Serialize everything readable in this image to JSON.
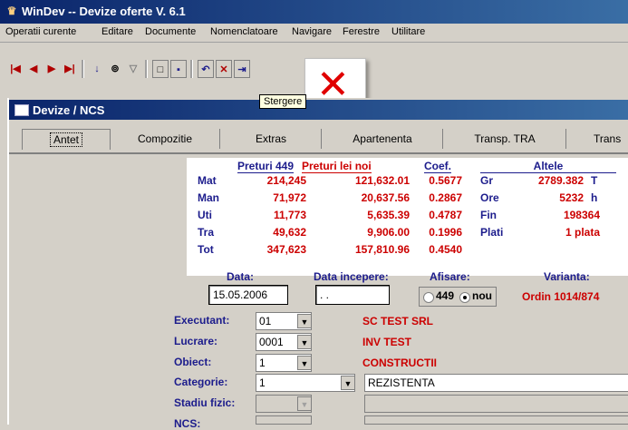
{
  "app": {
    "title": "WinDev -- Devize oferte V. 6.1"
  },
  "menu": [
    "Operatii curente",
    "Editare",
    "Documente",
    "Nomenclatoare",
    "Navigare",
    "Ferestre",
    "Utilitare"
  ],
  "tooltip": "Stergere",
  "window": {
    "title": "Devize / NCS"
  },
  "tabs": [
    "Antet",
    "Compozitie",
    "Extras",
    "Apartenenta",
    "Transp. TRA",
    "Trans"
  ],
  "prices": {
    "headers": {
      "p449": "Preturi 449",
      "pnoi": "Preturi lei noi",
      "coef": "Coef.",
      "altele": "Altele"
    },
    "rows": [
      {
        "label": "Mat",
        "p449": "214,245",
        "pnoi": "121,632.01",
        "coef": "0.5677"
      },
      {
        "label": "Man",
        "p449": "71,972",
        "pnoi": "20,637.56",
        "coef": "0.2867"
      },
      {
        "label": "Uti",
        "p449": "11,773",
        "pnoi": "5,635.39",
        "coef": "0.4787"
      },
      {
        "label": "Tra",
        "p449": "49,632",
        "pnoi": "9,906.00",
        "coef": "0.1996"
      },
      {
        "label": "Tot",
        "p449": "347,623",
        "pnoi": "157,810.96",
        "coef": "0.4540"
      }
    ],
    "altele": [
      {
        "label": "Gr",
        "value": "2789.382",
        "unit": "T"
      },
      {
        "label": "Ore",
        "value": "5232",
        "unit": "h"
      },
      {
        "label": "Fin",
        "value": "198364",
        "unit": ""
      },
      {
        "label": "Plati",
        "value": "1 plata",
        "unit": ""
      }
    ]
  },
  "data_label": "Data:",
  "data_value": "15.05.2006",
  "data_incep_label": "Data incepere:",
  "data_incep_value": ". .",
  "afisare_label": "Afisare:",
  "afisare_opt1": "449",
  "afisare_opt2": "nou",
  "varianta_label": "Varianta:",
  "varianta_value": "Ordin 1014/874",
  "fields": {
    "executant": {
      "label": "Executant:",
      "code": "01",
      "name": "SC TEST SRL"
    },
    "lucrare": {
      "label": "Lucrare:",
      "code": "0001",
      "name": "INV TEST"
    },
    "obiect": {
      "label": "Obiect:",
      "code": "1",
      "name": "CONSTRUCTII"
    },
    "categorie": {
      "label": "Categorie:",
      "code": "1",
      "name": "REZISTENTA"
    },
    "stadiu": {
      "label": "Stadiu fizic:"
    },
    "ncs": {
      "label": "NCS:"
    }
  }
}
